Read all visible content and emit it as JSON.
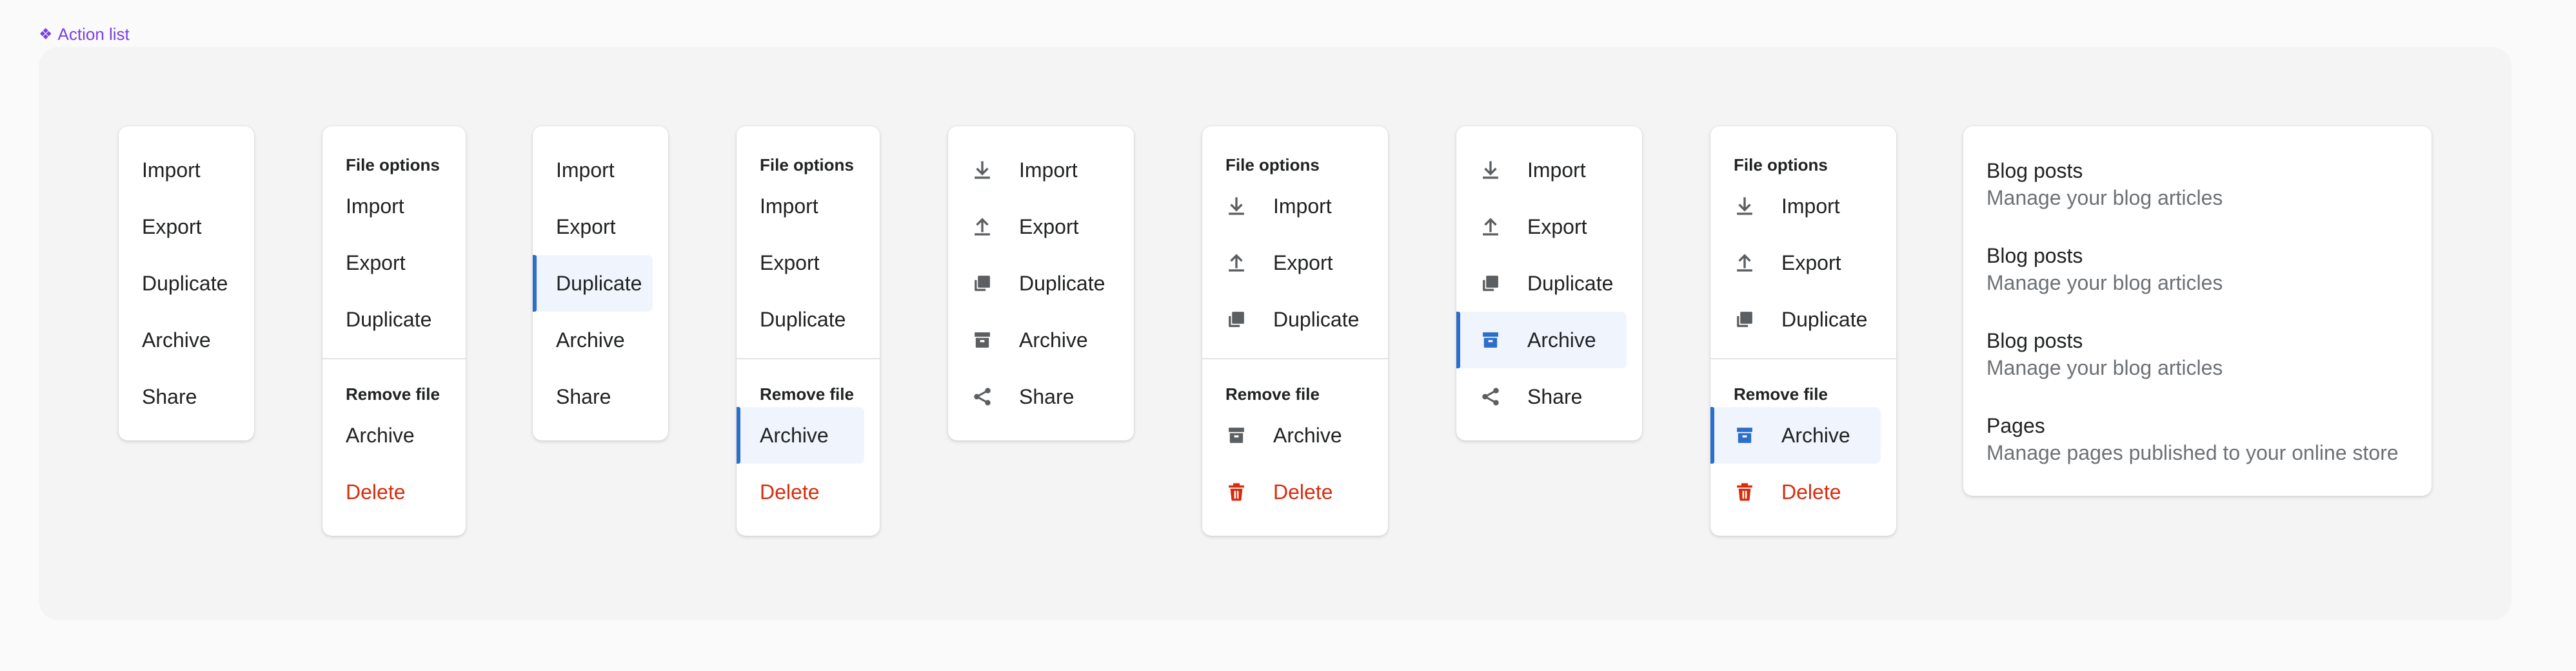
{
  "frame_label": "Action list",
  "labels": {
    "import": "Import",
    "export": "Export",
    "duplicate": "Duplicate",
    "archive": "Archive",
    "share": "Share",
    "delete": "Delete",
    "file_options": "File options",
    "remove_file": "Remove file"
  },
  "description_list": [
    {
      "title": "Blog posts",
      "description": "Manage your blog articles"
    },
    {
      "title": "Blog posts",
      "description": "Manage your blog articles"
    },
    {
      "title": "Blog posts",
      "description": "Manage your blog articles"
    },
    {
      "title": "Pages",
      "description": "Manage pages published to your online store"
    }
  ],
  "colors": {
    "icon": "#5c5f62",
    "active_icon": "#2c6ecb",
    "active_bar": "#2c6ecb",
    "destructive": "#d72c0d",
    "label_accent": "#7b3fe4"
  }
}
